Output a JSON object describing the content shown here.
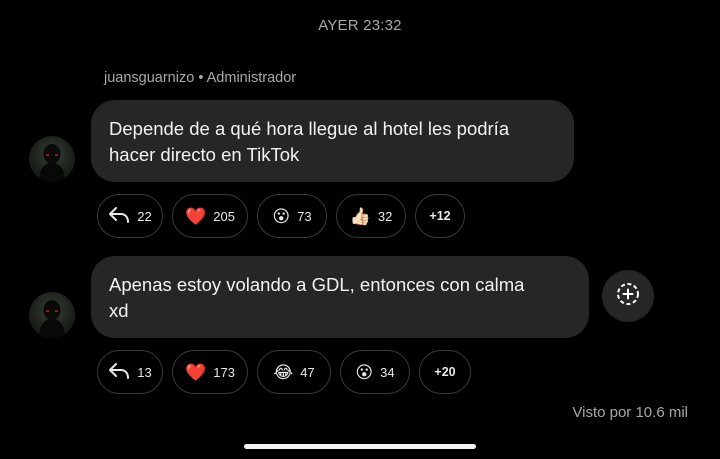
{
  "timestamp": "AYER 23:32",
  "sender": {
    "name": "juansguarnizo",
    "separator": "•",
    "role": "Administrador"
  },
  "messages": [
    {
      "line1": "Depende de a qué hora llegue al hotel les podría",
      "line2": "hacer directo en TikTok",
      "reactions": [
        {
          "type": "reply",
          "icon": "reply-icon",
          "count": "22"
        },
        {
          "type": "emoji",
          "emoji": "❤️",
          "icon": "heart-icon",
          "count": "205"
        },
        {
          "type": "emoji",
          "emoji": "😮",
          "icon": "surprised-face-icon",
          "count": "73"
        },
        {
          "type": "emoji",
          "emoji": "👍🏻",
          "icon": "thumbs-up-icon",
          "count": "32"
        },
        {
          "type": "more",
          "count": "+12"
        }
      ]
    },
    {
      "line1": "Apenas estoy volando a GDL, entonces con calma",
      "line2": "xd",
      "reactions": [
        {
          "type": "reply",
          "icon": "reply-icon",
          "count": "13"
        },
        {
          "type": "emoji",
          "emoji": "❤️",
          "icon": "heart-icon",
          "count": "173"
        },
        {
          "type": "emoji",
          "emoji": "😂",
          "icon": "laughing-face-icon",
          "count": "47"
        },
        {
          "type": "emoji",
          "emoji": "😮",
          "icon": "surprised-face-icon",
          "count": "34"
        },
        {
          "type": "more",
          "count": "+20"
        }
      ]
    }
  ],
  "seen_by": "Visto por 10.6 mil",
  "colors": {
    "background": "#000000",
    "bubble": "#262626",
    "muted_text": "#a8a8a8",
    "pill_border": "#3a3a3a"
  }
}
